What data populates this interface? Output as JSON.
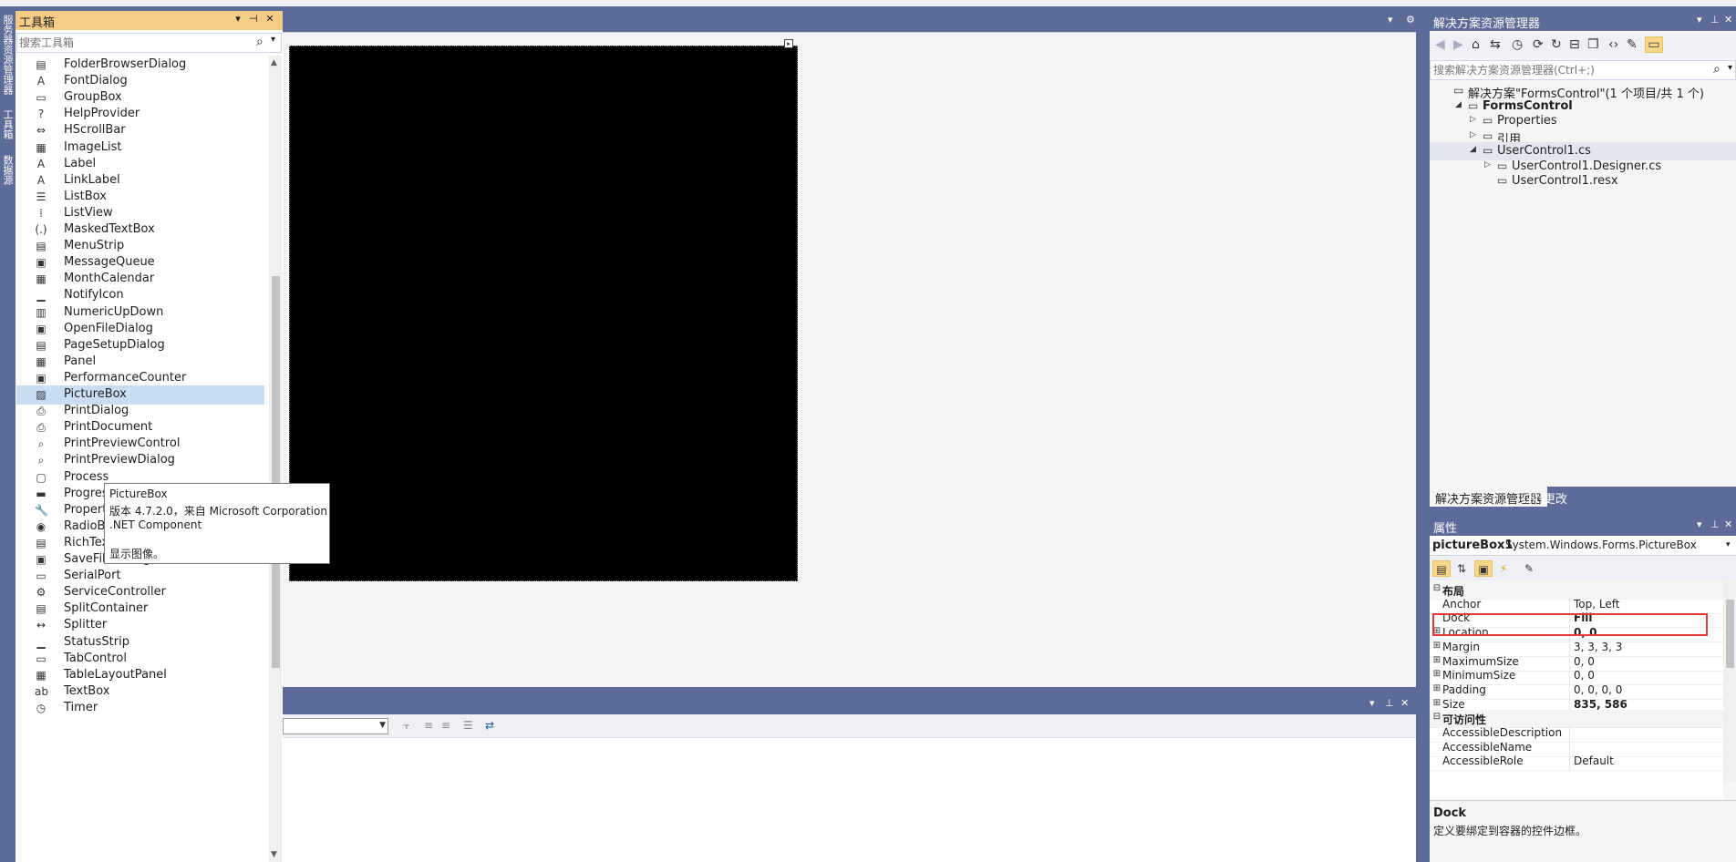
{
  "side_tabs": [
    "服务器资源管理器",
    "工具箱",
    "数据源"
  ],
  "toolbox": {
    "title": "工具箱",
    "search_placeholder": "搜索工具箱",
    "items": [
      {
        "label": "FolderBrowserDialog",
        "icon": "folder-browser-icon",
        "glyph": "▤"
      },
      {
        "label": "FontDialog",
        "icon": "font-dialog-icon",
        "glyph": "A"
      },
      {
        "label": "GroupBox",
        "icon": "group-box-icon",
        "glyph": "▭"
      },
      {
        "label": "HelpProvider",
        "icon": "help-provider-icon",
        "glyph": "?"
      },
      {
        "label": "HScrollBar",
        "icon": "hscrollbar-icon",
        "glyph": "⇔"
      },
      {
        "label": "ImageList",
        "icon": "image-list-icon",
        "glyph": "▦"
      },
      {
        "label": "Label",
        "icon": "label-icon",
        "glyph": "A"
      },
      {
        "label": "LinkLabel",
        "icon": "link-label-icon",
        "glyph": "A"
      },
      {
        "label": "ListBox",
        "icon": "list-box-icon",
        "glyph": "☰"
      },
      {
        "label": "ListView",
        "icon": "list-view-icon",
        "glyph": "⁞"
      },
      {
        "label": "MaskedTextBox",
        "icon": "masked-textbox-icon",
        "glyph": "(.)"
      },
      {
        "label": "MenuStrip",
        "icon": "menu-strip-icon",
        "glyph": "▤"
      },
      {
        "label": "MessageQueue",
        "icon": "message-queue-icon",
        "glyph": "▣"
      },
      {
        "label": "MonthCalendar",
        "icon": "month-calendar-icon",
        "glyph": "▦"
      },
      {
        "label": "NotifyIcon",
        "icon": "notify-icon-icon",
        "glyph": "▁"
      },
      {
        "label": "NumericUpDown",
        "icon": "numeric-updown-icon",
        "glyph": "▥"
      },
      {
        "label": "OpenFileDialog",
        "icon": "open-file-dialog-icon",
        "glyph": "▣"
      },
      {
        "label": "PageSetupDialog",
        "icon": "page-setup-dialog-icon",
        "glyph": "▤"
      },
      {
        "label": "Panel",
        "icon": "panel-icon",
        "glyph": "▦"
      },
      {
        "label": "PerformanceCounter",
        "icon": "performance-counter-icon",
        "glyph": "▣"
      },
      {
        "label": "PictureBox",
        "icon": "picture-box-icon",
        "glyph": "▨",
        "selected": true
      },
      {
        "label": "PrintDialog",
        "icon": "print-dialog-icon",
        "glyph": "⎙"
      },
      {
        "label": "PrintDocument",
        "icon": "print-document-icon",
        "glyph": "⎙"
      },
      {
        "label": "PrintPreviewControl",
        "icon": "print-preview-control-icon",
        "glyph": "⌕"
      },
      {
        "label": "PrintPreviewDialog",
        "icon": "print-preview-dialog-icon",
        "glyph": "⌕"
      },
      {
        "label": "Process",
        "icon": "process-icon",
        "glyph": "▢"
      },
      {
        "label": "ProgressBar",
        "icon": "progress-bar-icon",
        "glyph": "▬"
      },
      {
        "label": "PropertyGrid",
        "icon": "property-grid-icon",
        "glyph": "🔧"
      },
      {
        "label": "RadioButton",
        "icon": "radio-button-icon",
        "glyph": "◉"
      },
      {
        "label": "RichTextBox",
        "icon": "rich-textbox-icon",
        "glyph": "▤"
      },
      {
        "label": "SaveFileDialog",
        "icon": "save-file-dialog-icon",
        "glyph": "▣"
      },
      {
        "label": "SerialPort",
        "icon": "serial-port-icon",
        "glyph": "▭"
      },
      {
        "label": "ServiceController",
        "icon": "service-controller-icon",
        "glyph": "⚙"
      },
      {
        "label": "SplitContainer",
        "icon": "split-container-icon",
        "glyph": "▤"
      },
      {
        "label": "Splitter",
        "icon": "splitter-icon",
        "glyph": "↔"
      },
      {
        "label": "StatusStrip",
        "icon": "status-strip-icon",
        "glyph": "▁"
      },
      {
        "label": "TabControl",
        "icon": "tab-control-icon",
        "glyph": "▭"
      },
      {
        "label": "TableLayoutPanel",
        "icon": "table-layout-panel-icon",
        "glyph": "▦"
      },
      {
        "label": "TextBox",
        "icon": "textbox-icon",
        "glyph": "ab"
      },
      {
        "label": "Timer",
        "icon": "timer-icon",
        "glyph": "◷"
      }
    ]
  },
  "tooltip": {
    "title": "PictureBox",
    "version": "版本 4.7.2.0，来自 Microsoft Corporation",
    "component": ".NET Component",
    "description": "显示图像。"
  },
  "solution_explorer": {
    "title": "解决方案资源管理器",
    "search_placeholder": "搜索解决方案资源管理器(Ctrl+;)",
    "tree": [
      {
        "label": "解决方案\"FormsControl\"(1 个项目/共 1 个)",
        "icon": "solution-icon",
        "depth": 0,
        "expander": ""
      },
      {
        "label": "FormsControl",
        "icon": "csharp-project-icon",
        "depth": 1,
        "expander": "◢",
        "bold": true
      },
      {
        "label": "Properties",
        "icon": "wrench-icon",
        "depth": 2,
        "expander": "▷"
      },
      {
        "label": "引用",
        "icon": "references-icon",
        "depth": 2,
        "expander": "▷"
      },
      {
        "label": "UserControl1.cs",
        "icon": "user-control-icon",
        "depth": 2,
        "expander": "◢",
        "selected": true
      },
      {
        "label": "UserControl1.Designer.cs",
        "icon": "cs-file-icon",
        "depth": 3,
        "expander": "▷"
      },
      {
        "label": "UserControl1.resx",
        "icon": "resx-file-icon",
        "depth": 3,
        "expander": ""
      }
    ],
    "tabs": [
      "解决方案资源管理器",
      "Git 更改"
    ]
  },
  "properties": {
    "title": "属性",
    "object_name": "pictureBox1",
    "object_type": "System.Windows.Forms.PictureBox",
    "rows": [
      {
        "name": "布局",
        "category": true,
        "expander": "⊟"
      },
      {
        "name": "Anchor",
        "value": "Top, Left",
        "expander": ""
      },
      {
        "name": "Dock",
        "value": "Fill",
        "bold": true,
        "expander": ""
      },
      {
        "name": "Location",
        "value": "0, 0",
        "bold": true,
        "expander": "⊞"
      },
      {
        "name": "Margin",
        "value": "3, 3, 3, 3",
        "expander": "⊞"
      },
      {
        "name": "MaximumSize",
        "value": "0, 0",
        "expander": "⊞"
      },
      {
        "name": "MinimumSize",
        "value": "0, 0",
        "expander": "⊞"
      },
      {
        "name": "Padding",
        "value": "0, 0, 0, 0",
        "expander": "⊞"
      },
      {
        "name": "Size",
        "value": "835, 586",
        "bold": true,
        "expander": "⊞"
      },
      {
        "name": "可访问性",
        "category": true,
        "expander": "⊟"
      },
      {
        "name": "AccessibleDescription",
        "value": "",
        "expander": ""
      },
      {
        "name": "AccessibleName",
        "value": "",
        "expander": ""
      },
      {
        "name": "AccessibleRole",
        "value": "Default",
        "expander": ""
      }
    ],
    "description_title": "Dock",
    "description_text": "定义要绑定到容器的控件边框。"
  },
  "colors": {
    "chrome": "#5d6b99",
    "toolbox_header": "#f5cc84",
    "selection": "#c9def5",
    "highlight_box": "#e53935"
  }
}
